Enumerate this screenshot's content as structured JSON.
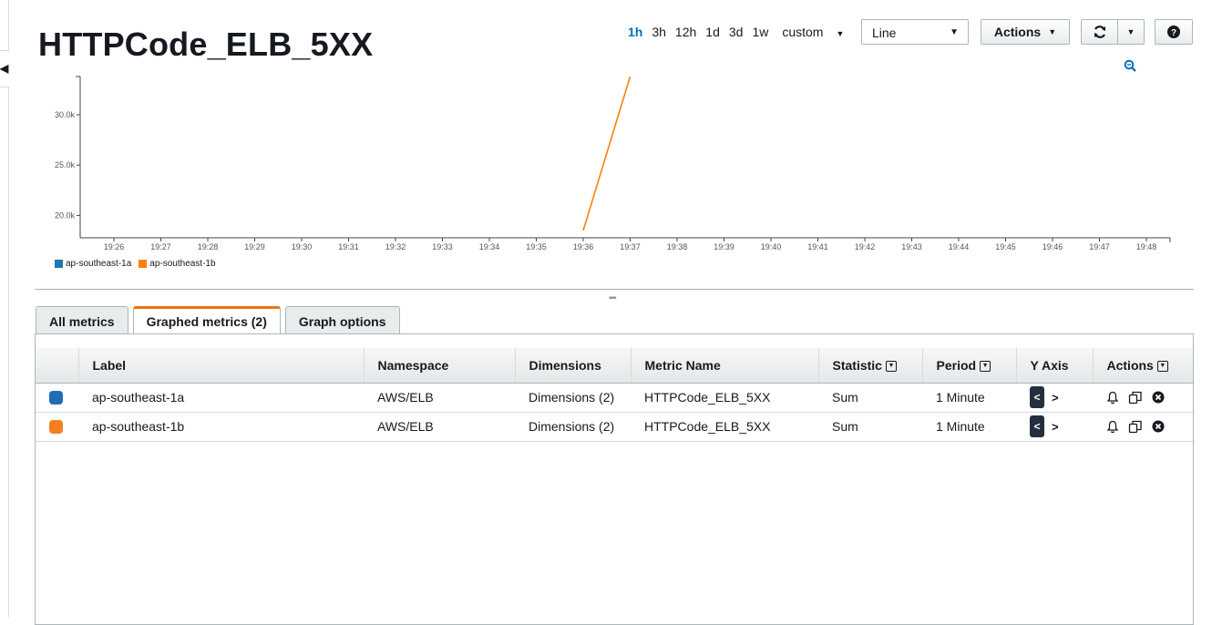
{
  "page": {
    "title": "HTTPCode_ELB_5XX"
  },
  "toolbar": {
    "ranges": [
      "1h",
      "3h",
      "12h",
      "1d",
      "3d",
      "1w"
    ],
    "active_range": "1h",
    "custom_label": "custom",
    "graph_type_value": "Line",
    "actions_label": "Actions"
  },
  "chart_data": {
    "type": "line",
    "x_ticks": [
      "19:26",
      "19:27",
      "19:28",
      "19:29",
      "19:30",
      "19:31",
      "19:32",
      "19:33",
      "19:34",
      "19:35",
      "19:36",
      "19:37",
      "19:38",
      "19:39",
      "19:40",
      "19:41",
      "19:42",
      "19:43",
      "19:44",
      "19:45",
      "19:46",
      "19:47",
      "19:48"
    ],
    "y_ticks": [
      "20.0k",
      "25.0k",
      "30.0k"
    ],
    "y_tick_values": [
      20000,
      25000,
      30000
    ],
    "ylim": [
      18500,
      33800
    ],
    "series": [
      {
        "name": "ap-southeast-1a",
        "color": "#1f77b4",
        "points": []
      },
      {
        "name": "ap-southeast-1b",
        "color": "#ff7f0e",
        "points": [
          {
            "x": "19:36",
            "y": 18500
          },
          {
            "x": "19:37",
            "y": 33800
          }
        ]
      }
    ]
  },
  "tabs": [
    {
      "label": "All metrics",
      "active": false
    },
    {
      "label": "Graphed metrics (2)",
      "active": true
    },
    {
      "label": "Graph options",
      "active": false
    }
  ],
  "table": {
    "columns": {
      "label": "Label",
      "namespace": "Namespace",
      "dimensions": "Dimensions",
      "metric_name": "Metric Name",
      "statistic": "Statistic",
      "period": "Period",
      "y_axis": "Y Axis",
      "actions": "Actions"
    },
    "rows": [
      {
        "color": "#1f6eb5",
        "label": "ap-southeast-1a",
        "namespace": "AWS/ELB",
        "dimensions": "Dimensions (2)",
        "metric_name": "HTTPCode_ELB_5XX",
        "statistic": "Sum",
        "period": "1 Minute"
      },
      {
        "color": "#f57f20",
        "label": "ap-southeast-1b",
        "namespace": "AWS/ELB",
        "dimensions": "Dimensions (2)",
        "metric_name": "HTTPCode_ELB_5XX",
        "statistic": "Sum",
        "period": "1 Minute"
      }
    ]
  }
}
